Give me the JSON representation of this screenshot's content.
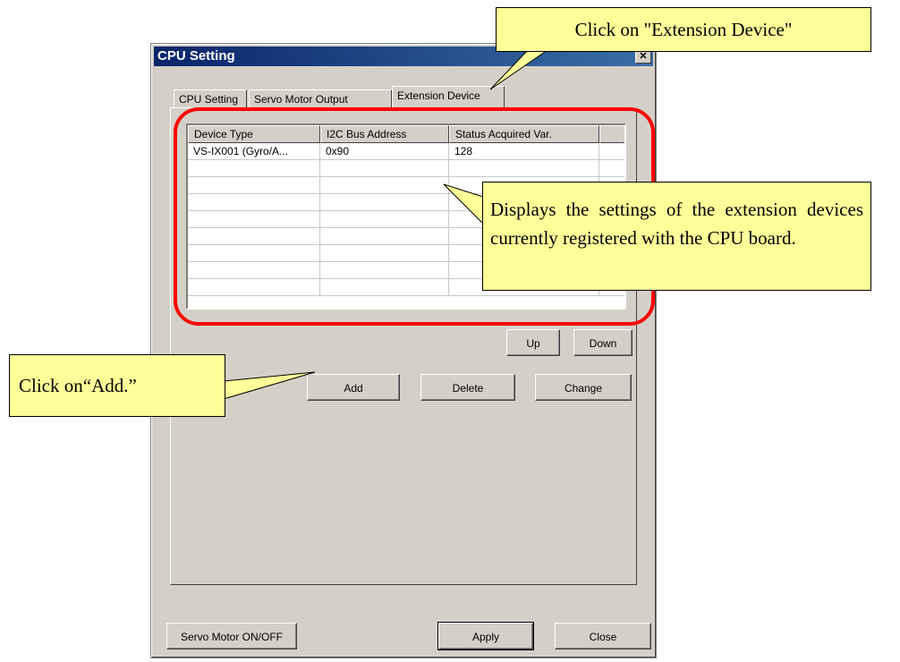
{
  "dialog": {
    "title": "CPU Setting",
    "close_glyph": "✕"
  },
  "tabs": [
    {
      "label": "CPU Setting"
    },
    {
      "label": "Servo Motor Output"
    },
    {
      "label": "Extension Device"
    }
  ],
  "listview": {
    "columns": [
      "Device Type",
      "I2C Bus Address",
      "Status Acquired Var."
    ],
    "rows": [
      [
        "VS-IX001 (Gyro/A...",
        "0x90",
        "128"
      ]
    ]
  },
  "buttons": {
    "up": "Up",
    "down": "Down",
    "add": "Add",
    "delete": "Delete",
    "change": "Change",
    "servo_on_off": "Servo Motor ON/OFF",
    "apply": "Apply",
    "close": "Close"
  },
  "callouts": {
    "extension": "Click on \"Extension Device\"",
    "displays": "Displays the settings of the extension devices currently registered with the CPU board.",
    "add": "Click on“Add.”"
  },
  "colors": {
    "highlight": "#ff0000",
    "callout_bg": "#ffff99",
    "dialog_bg": "#d4d0c8"
  }
}
